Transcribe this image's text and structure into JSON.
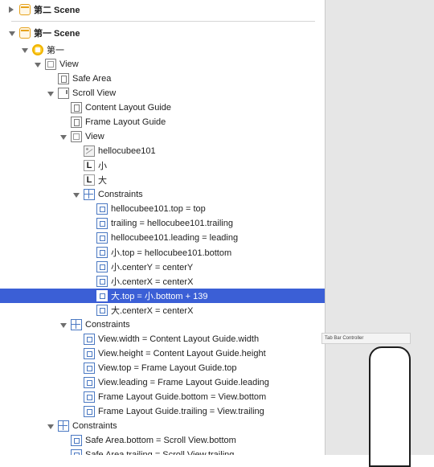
{
  "outline": {
    "rows": [
      {
        "label": "第二 Scene",
        "icon": "scene-icon",
        "disclosure": "closed",
        "indent": 0,
        "kind": "scene"
      },
      {
        "label": "第一 Scene",
        "icon": "scene-icon",
        "disclosure": "open",
        "indent": 0,
        "kind": "scene"
      },
      {
        "label": "第一",
        "icon": "view-controller-icon",
        "disclosure": "open",
        "indent": 1
      },
      {
        "label": "View",
        "icon": "view-icon",
        "disclosure": "open",
        "indent": 2
      },
      {
        "label": "Safe Area",
        "icon": "layout-guide-icon",
        "disclosure": "none",
        "indent": 3
      },
      {
        "label": "Scroll View",
        "icon": "scroll-view-icon",
        "disclosure": "open",
        "indent": 3
      },
      {
        "label": "Content Layout Guide",
        "icon": "layout-guide-icon",
        "disclosure": "none",
        "indent": 4
      },
      {
        "label": "Frame Layout Guide",
        "icon": "layout-guide-icon",
        "disclosure": "none",
        "indent": 4
      },
      {
        "label": "View",
        "icon": "view-icon",
        "disclosure": "open",
        "indent": 4
      },
      {
        "label": "hellocubee101",
        "icon": "image-view-icon",
        "disclosure": "none",
        "indent": 5
      },
      {
        "label": "小",
        "icon": "label-icon",
        "disclosure": "none",
        "indent": 5
      },
      {
        "label": "大",
        "icon": "label-icon",
        "disclosure": "none",
        "indent": 5
      },
      {
        "label": "Constraints",
        "icon": "constraints-icon",
        "disclosure": "open",
        "indent": 5
      },
      {
        "label": "hellocubee101.top = top",
        "icon": "constraint-icon",
        "disclosure": "none",
        "indent": 6
      },
      {
        "label": "trailing = hellocubee101.trailing",
        "icon": "constraint-icon",
        "disclosure": "none",
        "indent": 6
      },
      {
        "label": "hellocubee101.leading = leading",
        "icon": "constraint-icon",
        "disclosure": "none",
        "indent": 6
      },
      {
        "label": "小.top = hellocubee101.bottom",
        "icon": "constraint-icon",
        "disclosure": "none",
        "indent": 6
      },
      {
        "label": "小.centerY = centerY",
        "icon": "constraint-icon",
        "disclosure": "none",
        "indent": 6
      },
      {
        "label": "小.centerX = centerX",
        "icon": "constraint-icon",
        "disclosure": "none",
        "indent": 6
      },
      {
        "label": "大.top = 小.bottom + 139",
        "icon": "constraint-icon",
        "disclosure": "none",
        "indent": 6,
        "selected": true
      },
      {
        "label": "大.centerX = centerX",
        "icon": "constraint-icon",
        "disclosure": "none",
        "indent": 6
      },
      {
        "label": "Constraints",
        "icon": "constraints-icon",
        "disclosure": "open",
        "indent": 4
      },
      {
        "label": "View.width = Content Layout Guide.width",
        "icon": "constraint-icon",
        "disclosure": "none",
        "indent": 5
      },
      {
        "label": "View.height = Content Layout Guide.height",
        "icon": "constraint-icon",
        "disclosure": "none",
        "indent": 5
      },
      {
        "label": "View.top = Frame Layout Guide.top",
        "icon": "constraint-icon",
        "disclosure": "none",
        "indent": 5
      },
      {
        "label": "View.leading = Frame Layout Guide.leading",
        "icon": "constraint-icon",
        "disclosure": "none",
        "indent": 5
      },
      {
        "label": "Frame Layout Guide.bottom = View.bottom",
        "icon": "constraint-icon",
        "disclosure": "none",
        "indent": 5
      },
      {
        "label": "Frame Layout Guide.trailing = View.trailing",
        "icon": "constraint-icon",
        "disclosure": "none",
        "indent": 5
      },
      {
        "label": "Constraints",
        "icon": "constraints-icon",
        "disclosure": "open",
        "indent": 3
      },
      {
        "label": "Safe Area.bottom = Scroll View.bottom",
        "icon": "constraint-icon",
        "disclosure": "none",
        "indent": 4
      },
      {
        "label": "Safe Area.trailing = Scroll View.trailing",
        "icon": "constraint-icon",
        "disclosure": "none",
        "indent": 4
      }
    ]
  },
  "canvas": {
    "scene_label": "Tab Bar Controller"
  }
}
